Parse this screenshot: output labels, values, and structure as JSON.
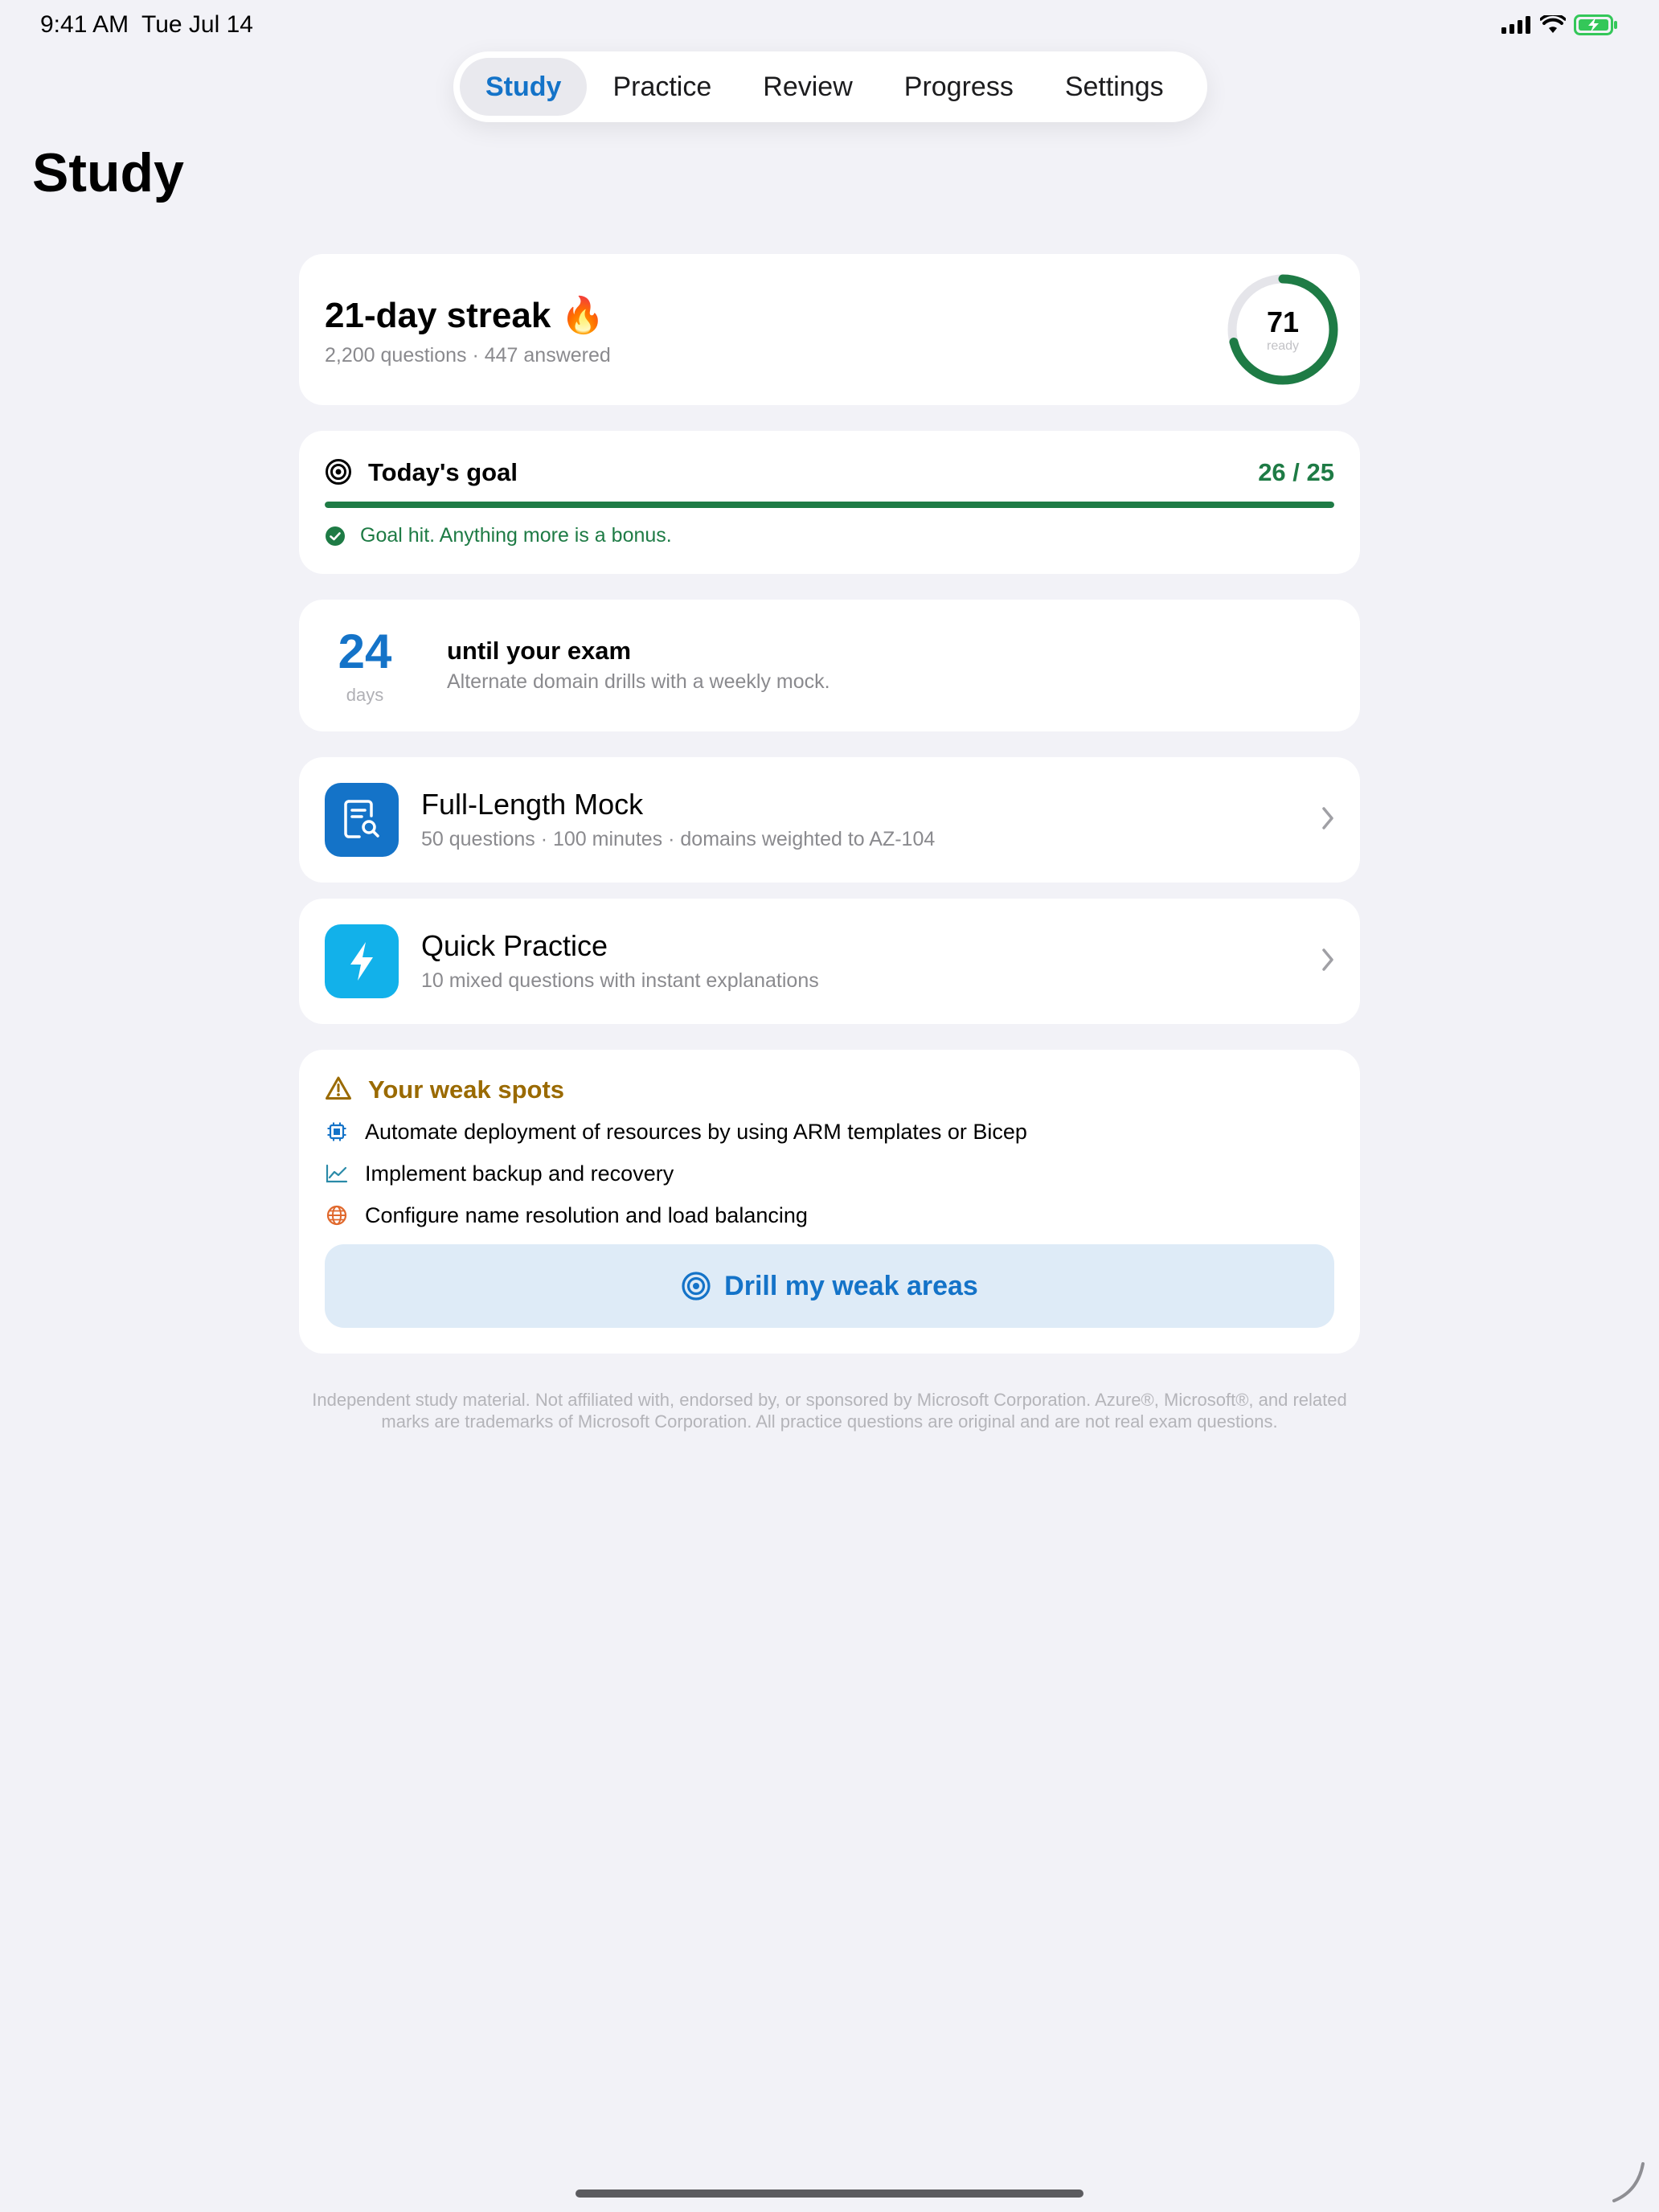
{
  "status_bar": {
    "time": "9:41 AM",
    "date": "Tue Jul 14",
    "icons": [
      "cellular-signal-icon",
      "wifi-icon",
      "battery-charging-icon"
    ],
    "battery_color": "#34c759"
  },
  "tabs": [
    {
      "label": "Study",
      "active": true
    },
    {
      "label": "Practice",
      "active": false
    },
    {
      "label": "Review",
      "active": false
    },
    {
      "label": "Progress",
      "active": false
    },
    {
      "label": "Settings",
      "active": false
    }
  ],
  "page_title": "Study",
  "streak": {
    "title": "21-day streak",
    "emoji": "🔥",
    "subtitle": "2,200 questions · 447 answered",
    "readiness_value": "71",
    "readiness_label": "ready",
    "readiness_fraction": 0.71
  },
  "goal": {
    "title": "Today's goal",
    "count": "26 / 25",
    "progress_fraction": 1.0,
    "message": "Goal hit. Anything more is a bonus.",
    "icon": "target-icon"
  },
  "exam": {
    "days": "24",
    "days_label": "days",
    "title": "until your exam",
    "subtitle": "Alternate domain drills with a weekly mock."
  },
  "mock": {
    "title": "Full-Length Mock",
    "subtitle": "50 questions · 100 minutes · domains weighted to AZ-104",
    "icon": "document-search-icon",
    "icon_bg": "#1473c8"
  },
  "quick": {
    "title": "Quick Practice",
    "subtitle": "10 mixed questions with instant explanations",
    "icon": "lightning-bolt-icon",
    "icon_bg": "#12b1ea"
  },
  "weak": {
    "title": "Your weak spots",
    "items": [
      {
        "label": "Automate deployment of resources by using ARM templates or Bicep",
        "icon": "chip-icon",
        "color": "#1473c8"
      },
      {
        "label": "Implement backup and recovery",
        "icon": "chart-line-icon",
        "color": "#2a8aa8"
      },
      {
        "label": "Configure name resolution and load balancing",
        "icon": "globe-icon",
        "color": "#e0682c"
      }
    ],
    "button_label": "Drill my weak areas"
  },
  "disclaimer": "Independent study material. Not affiliated with, endorsed by, or sponsored by Microsoft Corporation. Azure®, Microsoft®, and related marks are trademarks of Microsoft Corporation. All practice questions are original and are not real exam questions.",
  "colors": {
    "accent": "#1473c8",
    "success": "#1e7b45",
    "warning": "#9a6a00",
    "background": "#f2f2f7"
  }
}
